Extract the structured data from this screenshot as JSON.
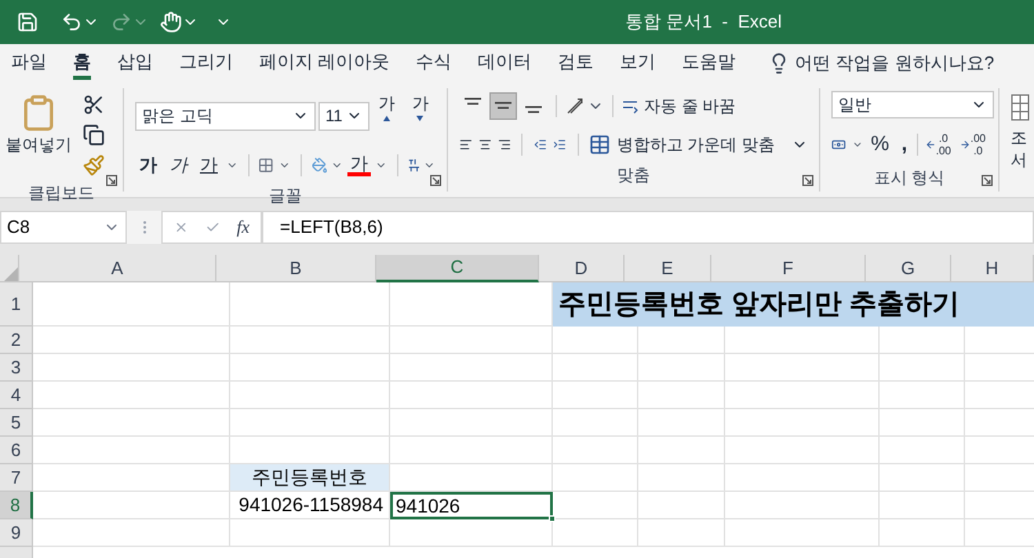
{
  "title_bar": {
    "title": "통합 문서1  -  Excel"
  },
  "menu_tabs": [
    {
      "label": "파일",
      "selected": false
    },
    {
      "label": "홈",
      "selected": true
    },
    {
      "label": "삽입",
      "selected": false
    },
    {
      "label": "그리기",
      "selected": false
    },
    {
      "label": "페이지 레이아웃",
      "selected": false
    },
    {
      "label": "수식",
      "selected": false
    },
    {
      "label": "데이터",
      "selected": false
    },
    {
      "label": "검토",
      "selected": false
    },
    {
      "label": "보기",
      "selected": false
    },
    {
      "label": "도움말",
      "selected": false
    }
  ],
  "tell_me": {
    "placeholder": "어떤 작업을 원하시나요?"
  },
  "clipboard": {
    "label": "클립보드",
    "paste": "붙여넣기"
  },
  "font": {
    "label": "글꼴",
    "font_name": "맑은 고딕",
    "font_size": "11",
    "size_buttons": [
      {
        "kind": "grow",
        "text": "가"
      },
      {
        "kind": "shrink",
        "text": "가"
      }
    ],
    "style_buttons": [
      {
        "kind": "bold",
        "text": "가"
      },
      {
        "kind": "italic",
        "text": "가"
      },
      {
        "kind": "underline",
        "text": "가"
      }
    ],
    "font_color": {
      "text": "가"
    }
  },
  "alignment": {
    "label": "맞춤",
    "vertical_buttons": [
      {
        "selected": false
      },
      {
        "selected": true
      },
      {
        "selected": false
      }
    ],
    "wrap_text": "자동 줄 바꿈",
    "merge": "병합하고 가운데 맞춤"
  },
  "number": {
    "label": "표시 형식",
    "format": "일반",
    "percent": "%",
    "comma": ",",
    "decimal_buttons": [
      {
        "kind": "increase",
        "top": ".0",
        "bottom": ".00"
      },
      {
        "kind": "decrease",
        "top": ".00",
        "bottom": ".0"
      }
    ]
  },
  "styles": {
    "top": "조",
    "bottom": "서"
  },
  "formula_bar": {
    "name_box": "C8",
    "fx": "fx",
    "formula": "=LEFT(B8,6)"
  },
  "columns": [
    {
      "label": "A",
      "selected": false
    },
    {
      "label": "B",
      "selected": false
    },
    {
      "label": "C",
      "selected": true
    },
    {
      "label": "D",
      "selected": false
    },
    {
      "label": "E",
      "selected": false
    },
    {
      "label": "F",
      "selected": false
    },
    {
      "label": "G",
      "selected": false
    },
    {
      "label": "H",
      "selected": false
    }
  ],
  "rows": [
    {
      "label": "1",
      "selected": false
    },
    {
      "label": "2",
      "selected": false
    },
    {
      "label": "3",
      "selected": false
    },
    {
      "label": "4",
      "selected": false
    },
    {
      "label": "5",
      "selected": false
    },
    {
      "label": "6",
      "selected": false
    },
    {
      "label": "7",
      "selected": false
    },
    {
      "label": "8",
      "selected": true
    },
    {
      "label": "9",
      "selected": false
    }
  ],
  "cells": [
    {
      "kind": "title",
      "text": "주민등록번호 앞자리만 추출하기"
    },
    {
      "kind": "header",
      "text": "주민등록번호"
    },
    {
      "kind": "value",
      "text": "941026-1158984"
    },
    {
      "kind": "active",
      "text": "941026"
    }
  ]
}
